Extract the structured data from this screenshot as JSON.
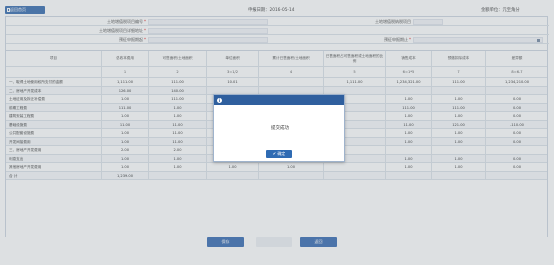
{
  "toolbar": {
    "back_label": "返回首页",
    "date_text": "申报日期：2016-05-14",
    "unit_text": "金额单位：元至角分"
  },
  "form": {
    "row1": {
      "label1": "土地增值税项目编号",
      "value1": "",
      "label2": "土地增值税纳税项目",
      "value2": ""
    },
    "row2": {
      "label1": "土地增值税项目详细地址",
      "value1": ""
    },
    "row3": {
      "label1": "预征申报期起",
      "value1": "",
      "label2": "预征申报期止",
      "value2": ""
    }
  },
  "table": {
    "headers": [
      "项目",
      "总收本费用",
      "可售面积/土地面积",
      "单位面积",
      "累计已售面积/土地面积",
      "已售面积占可售面积或土地面积的比例",
      "销售成本",
      "预缴扣除成本",
      "差异额"
    ],
    "index": [
      "",
      "1",
      "2",
      "3=1/2",
      "4",
      "5",
      "6=1*5",
      "7",
      "8=6-7"
    ],
    "rows": [
      [
        "一、取得土地使用权所支付的金额",
        "1,111.00",
        "111.00",
        "10.01",
        "",
        "1,111.00",
        "1,234,321.00",
        "111.00",
        "1,234,210.00"
      ],
      [
        "二、房地产开发成本",
        "126.00",
        "140.00",
        "",
        "",
        "",
        "",
        "",
        ""
      ],
      [
        "土地征用及拆迁补偿费",
        "1.00",
        "111.00",
        "",
        "",
        "",
        "1.00",
        "1.00",
        "0.00"
      ],
      [
        "前期工程费",
        "111.00",
        "1.00",
        "",
        "",
        "",
        "111.00",
        "111.00",
        "0.00"
      ],
      [
        "建筑安装工程费",
        "1.00",
        "1.00",
        "",
        "",
        "",
        "1.00",
        "1.00",
        "0.00"
      ],
      [
        "基础设施费",
        "11.00",
        "11.00",
        "",
        "",
        "",
        "11.00",
        "121.00",
        "-110.00"
      ],
      [
        "公共配套设施费",
        "1.00",
        "11.00",
        "",
        "",
        "",
        "1.00",
        "1.00",
        "0.00"
      ],
      [
        "开发间接费用",
        "1.00",
        "11.00",
        "0.09",
        "1.00",
        "",
        "1.00",
        "1.00",
        "0.00"
      ],
      [
        "三、房地产开发费用",
        "2.00",
        "2.00",
        "",
        "2.00",
        "",
        "",
        "",
        ""
      ],
      [
        "利息支出",
        "1.00",
        "1.00",
        "1.00",
        "1.00",
        "",
        "1.00",
        "1.00",
        "0.00"
      ],
      [
        "其他房地产开发费用",
        "1.00",
        "1.00",
        "1.00",
        "1.00",
        "",
        "1.00",
        "1.00",
        "0.00"
      ],
      [
        "合 计",
        "1,239.00",
        "",
        "",
        "",
        "",
        "",
        "",
        ""
      ]
    ]
  },
  "dialog": {
    "message": "提交成功",
    "confirm_label": "确定"
  },
  "footer": {
    "left_button": "保存",
    "right_button": "返回"
  }
}
